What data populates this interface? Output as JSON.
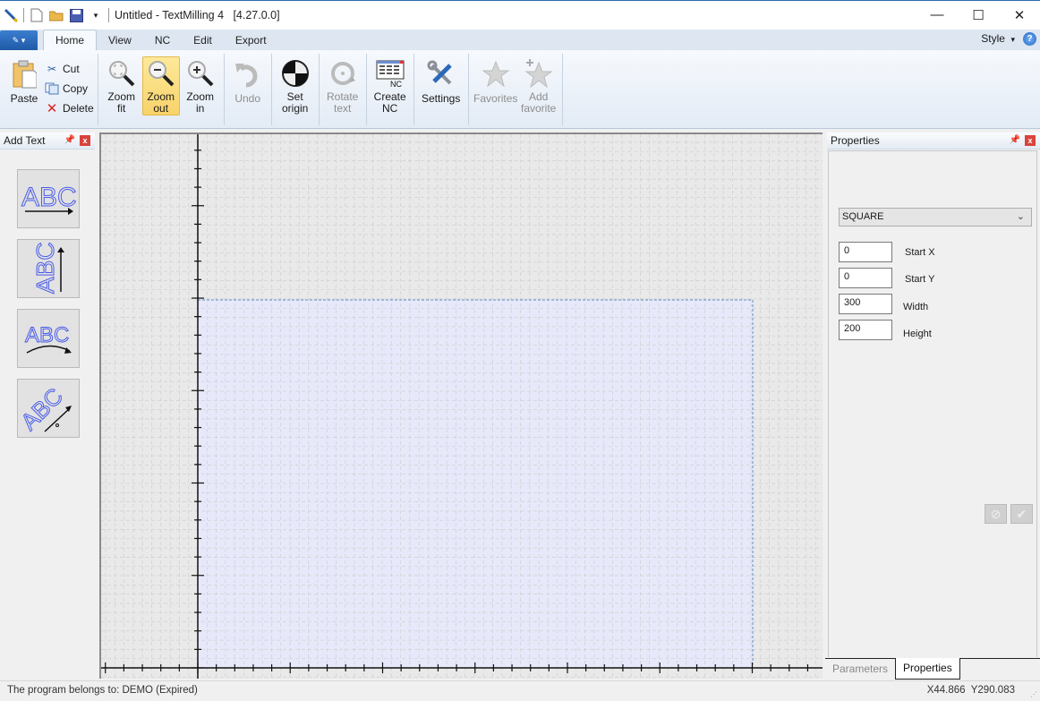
{
  "window": {
    "title": "Untitled - TextMilling 4   [4.27.0.0]",
    "controls": {
      "minimize": "—",
      "maximize": "☐",
      "close": "✕"
    }
  },
  "quick_access": [
    "pencil-icon",
    "new-file-icon",
    "open-folder-icon",
    "save-icon",
    "customize-dropdown-icon"
  ],
  "ribbon": {
    "tabs": [
      {
        "label": "Home",
        "active": true
      },
      {
        "label": "View",
        "active": false
      },
      {
        "label": "NC",
        "active": false
      },
      {
        "label": "Edit",
        "active": false
      },
      {
        "label": "Export",
        "active": false
      }
    ],
    "style_label": "Style",
    "help_label": "?",
    "clipboard": {
      "paste": "Paste",
      "cut": "Cut",
      "copy": "Copy",
      "delete": "Delete"
    },
    "zoom": {
      "fit": [
        "Zoom",
        "fit"
      ],
      "out": [
        "Zoom",
        "out"
      ],
      "in": [
        "Zoom",
        "in"
      ]
    },
    "undo": "Undo",
    "set_origin": [
      "Set",
      "origin"
    ],
    "rotate_text": [
      "Rotate",
      "text"
    ],
    "create_nc": [
      "Create",
      "NC"
    ],
    "settings": "Settings",
    "favorites": "Favorites",
    "add_favorite": [
      "Add",
      "favorite"
    ]
  },
  "left_panel": {
    "title": "Add Text",
    "tools": [
      "text-horizontal-tool",
      "text-vertical-tool",
      "text-arc-tool",
      "text-angle-tool"
    ],
    "tile_text": "ABC"
  },
  "canvas": {
    "rect_color": "#e8e8fb",
    "rect_border": "#5a8fc4"
  },
  "right_panel": {
    "title": "Properties",
    "shape_select": "SQUARE",
    "fields": [
      {
        "label": "Start X",
        "value": "0"
      },
      {
        "label": "Start Y",
        "value": "0"
      },
      {
        "label": "Width",
        "value": "300"
      },
      {
        "label": "Height",
        "value": "200"
      }
    ],
    "tabs": [
      {
        "label": "Parameters",
        "active": false
      },
      {
        "label": "Properties",
        "active": true
      }
    ]
  },
  "status": {
    "owner": "The program belongs to: DEMO (Expired)",
    "coords": "X44.866  Y290.083"
  }
}
